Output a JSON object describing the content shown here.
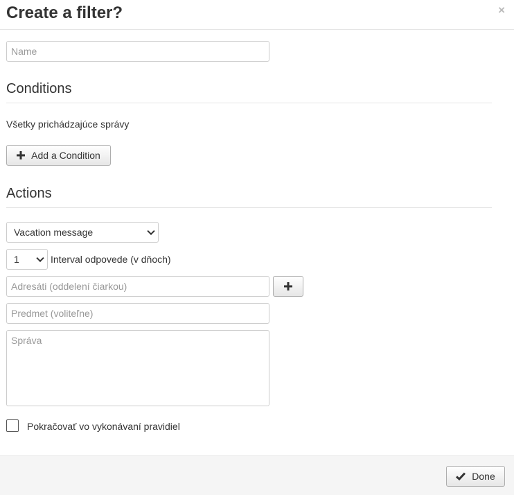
{
  "dialog": {
    "title": "Create a filter?",
    "close_glyph": "×"
  },
  "name_field": {
    "placeholder": "Name",
    "value": ""
  },
  "conditions": {
    "heading": "Conditions",
    "summary": "Všetky prichádzajúce správy",
    "add_button_label": "Add a Condition",
    "add_icon": "plus-icon"
  },
  "actions": {
    "heading": "Actions",
    "action_type": {
      "selected": "Vacation message"
    },
    "interval": {
      "selected": "1",
      "label": "Interval odpovede (v dňoch)"
    },
    "recipients": {
      "placeholder": "Adresáti (oddelení čiarkou)",
      "add_icon": "plus-icon"
    },
    "subject": {
      "placeholder": "Predmet (voliteľne)"
    },
    "message": {
      "placeholder": "Správa"
    },
    "continue_rules": {
      "label": "Pokračovať vo vykonávaní pravidiel",
      "checked": false
    }
  },
  "footer": {
    "done_label": "Done",
    "done_icon": "check-icon"
  }
}
